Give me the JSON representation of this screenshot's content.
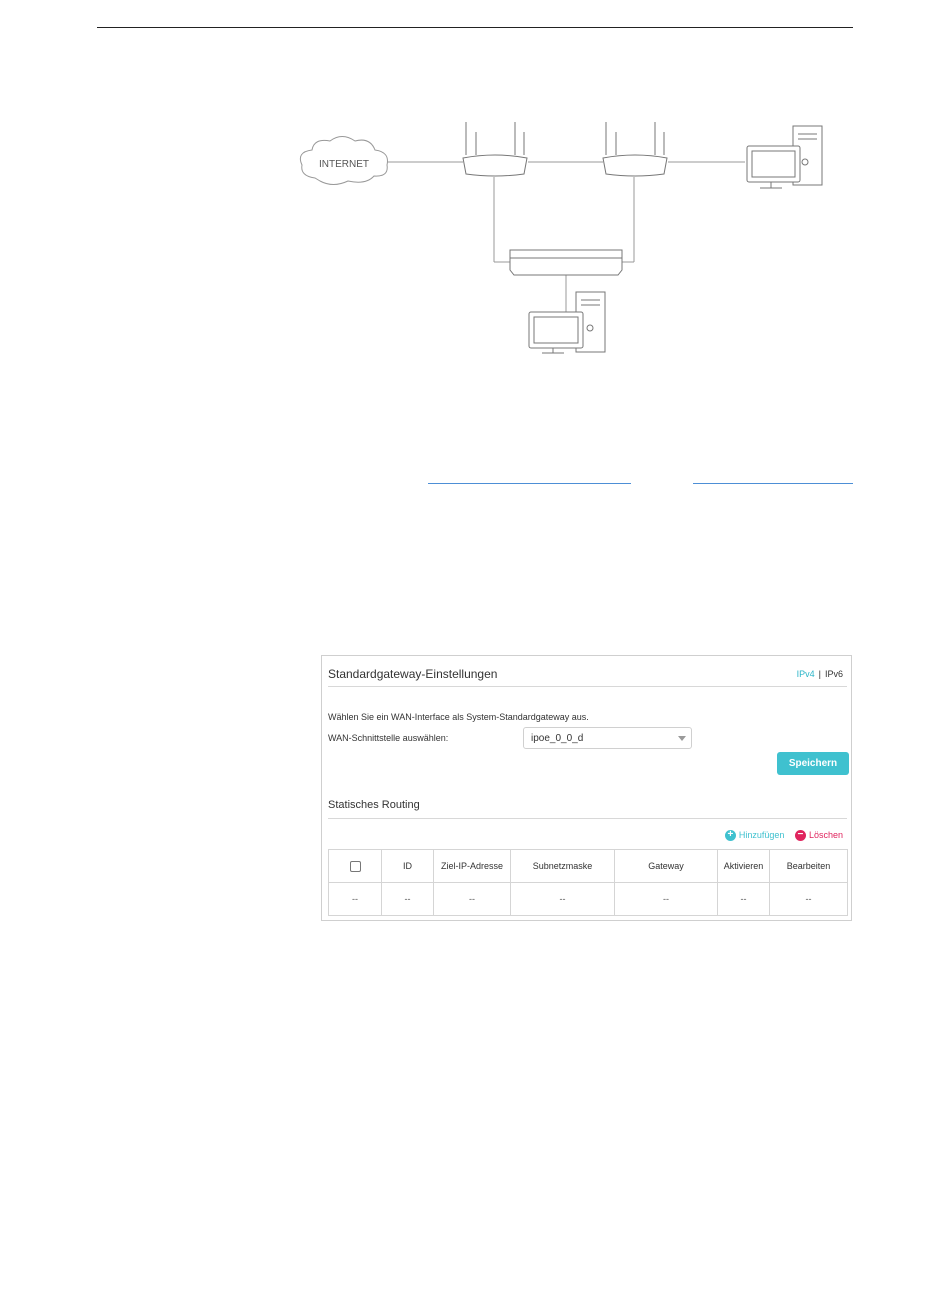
{
  "diagram": {
    "internet_label": "INTERNET"
  },
  "panel": {
    "title": "Standardgateway-Einstellungen",
    "ip_tabs": {
      "ipv4": "IPv4",
      "separator": "|",
      "ipv6": "IPv6"
    },
    "description": "Wählen Sie ein WAN-Interface als System-Standardgateway aus.",
    "wan_label": "WAN-Schnittstelle auswählen:",
    "wan_value": "ipoe_0_0_d",
    "save_label": "Speichern",
    "section_title": "Statisches Routing",
    "add_label": "Hinzufügen",
    "delete_label": "Löschen",
    "columns": [
      "ID",
      "Ziel-IP-Adresse",
      "Subnetzmaske",
      "Gateway",
      "Aktivieren",
      "Bearbeiten"
    ],
    "row": [
      "--",
      "--",
      "--",
      "--",
      "--",
      "--",
      "--"
    ]
  },
  "colors": {
    "accent": "#3fc1cf",
    "danger": "#e0245e",
    "link": "#4d8fd6"
  },
  "icons": {
    "add": "plus-circle-icon",
    "delete": "minus-circle-icon"
  }
}
